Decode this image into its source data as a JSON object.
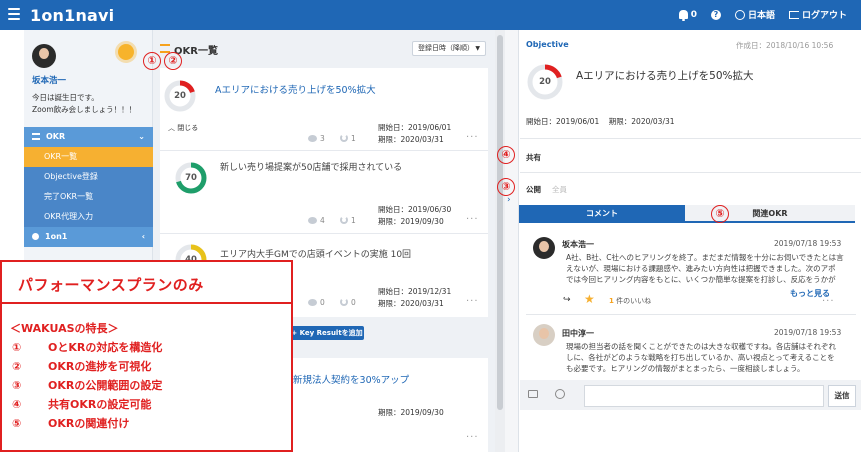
{
  "topbar": {
    "logo": "1on1navi",
    "notifications_count": "0",
    "help_icon": "?",
    "language": "日本語",
    "logout": "ログアウト",
    "color": "#1f67b5"
  },
  "sidebar": {
    "user_name": "坂本浩一",
    "message_line1": "今日は誕生日です。",
    "message_line2": "Zoom飲み会しましょう！！！",
    "nav_okr": "OKR",
    "nav_items": [
      "OKR一覧",
      "Objective登録",
      "完了OKR一覧",
      "OKR代理入力"
    ],
    "nav_1on1": "1on1"
  },
  "list": {
    "title": "OKR一覧",
    "sort_label": "登録日時（降順）",
    "collapse_label": "閉じる",
    "add_kr_label": "+ Key Resultを追加",
    "cards": [
      {
        "progress": 20,
        "progress_label": "20",
        "title": "Aエリアにおける売り上げを50%拡大",
        "start": "開始日：2019/06/01",
        "end": "期限：2020/03/31",
        "comments": "3",
        "reactions": "1",
        "color": "#e02020"
      },
      {
        "progress": 70,
        "progress_label": "70",
        "title": "新しい売り場提案が50店舗で採用されている",
        "start": "開始日：2019/06/30",
        "end": "期限：2019/09/30",
        "comments": "4",
        "reactions": "1",
        "color": "#1e9e6a"
      },
      {
        "progress": 40,
        "progress_label": "40",
        "title": "エリア内大手GMでの店頭イベントの実施 10回",
        "start": "開始日：2019/12/31",
        "end": "期限：2020/03/31",
        "comments": "0",
        "reactions": "0",
        "color": "#e8c21a"
      },
      {
        "title": "5新規法人契約を30%アップ",
        "end": "期限：2019/09/30"
      }
    ]
  },
  "detail": {
    "objective_label": "Objective",
    "created": "作成日：2018/10/16 10:56",
    "progress": 20,
    "progress_label": "20",
    "title": "Aエリアにおける売り上げを50%拡大",
    "start": "開始日：2019/06/01",
    "end": "期限：2020/03/31",
    "shared_label": "共有",
    "public_label": "公開",
    "public_value": "全員",
    "tab_comment": "コメント",
    "tab_related": "関連OKR",
    "comments": [
      {
        "name": "坂本浩一",
        "date": "2019/07/18 19:53",
        "lines": [
          "A社、B社、C社へのヒアリングを終了。まだまだ情報を十分にお伺いできたとは言",
          "えないが、現場における課題感や、進みたい方向性は把握できました。次のアポ",
          "では今回ヒアリング内容をもとに、いくつか簡単な提案を打診し、反応をうかが"
        ]
      },
      {
        "name": "田中淳一",
        "date": "2019/07/18 19:53",
        "lines": [
          "現場の担当者の話を聞くことができたのは大きな収穫ですね。各店舗はそれぞれ",
          "しに、各社がどのような戦略を打ち出しているか、高い視点とって考えることを",
          "も必要です。ヒアリングの情報がまとまったら、一度相談しましょう。"
        ]
      }
    ],
    "likes_count": "1",
    "likes_text": "件のいいね",
    "see_more": "もっと見る",
    "send_label": "送信"
  },
  "markers": [
    "①",
    "②",
    "③",
    "④",
    "⑤",
    "③",
    "⑤"
  ],
  "overlay": {
    "title": "パフォーマンスプランのみ",
    "heading": "＜WAKUASの特長＞",
    "items": [
      {
        "num": "①",
        "text": "OとKRの対応を構造化"
      },
      {
        "num": "②",
        "text": "OKRの進捗を可視化"
      },
      {
        "num": "③",
        "text": "OKRの公開範囲の設定"
      },
      {
        "num": "④",
        "text": "共有OKRの設定可能"
      },
      {
        "num": "⑤",
        "text": "OKRの関連付け"
      }
    ]
  }
}
